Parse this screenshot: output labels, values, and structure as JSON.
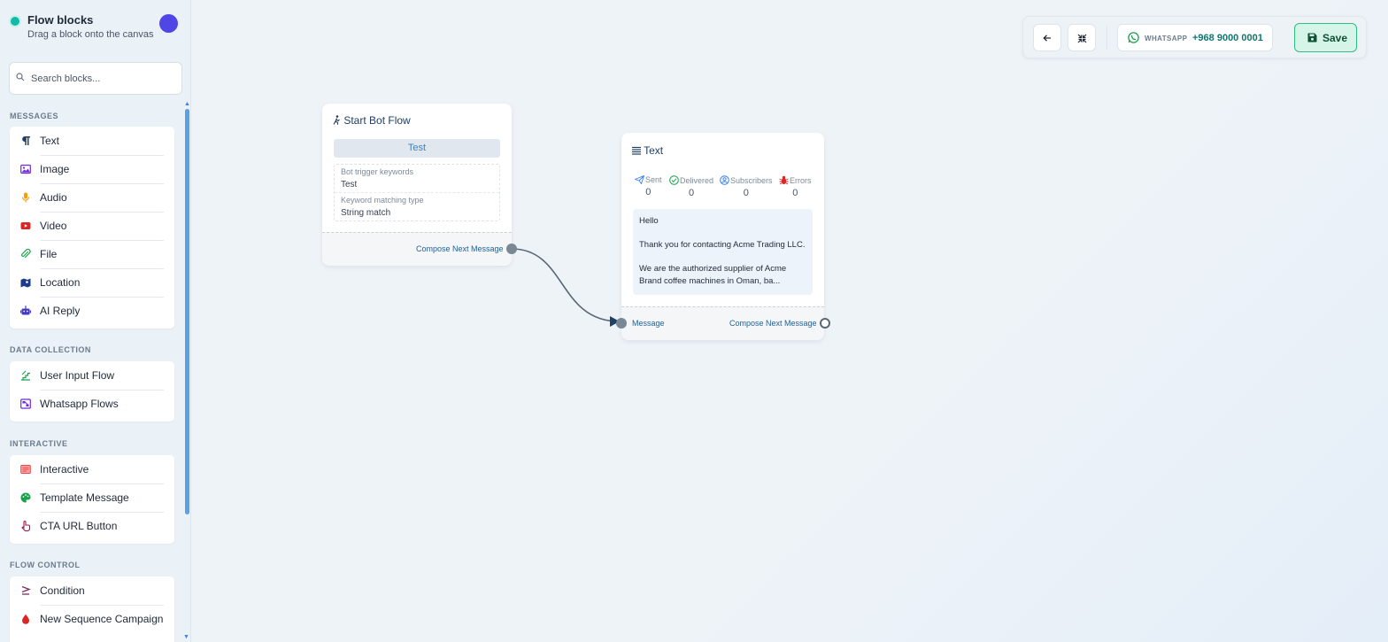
{
  "sidebar": {
    "title": "Flow blocks",
    "subtitle": "Drag a block onto the canvas",
    "search_placeholder": "Search blocks...",
    "sections": [
      {
        "title": "MESSAGES",
        "items": [
          {
            "label": "Text",
            "icon": "paragraph-icon",
            "color": "#1f3f64"
          },
          {
            "label": "Image",
            "icon": "image-icon",
            "color": "#6d28d9"
          },
          {
            "label": "Audio",
            "icon": "microphone-icon",
            "color": "#f59e0b"
          },
          {
            "label": "Video",
            "icon": "video-icon",
            "color": "#dc2626"
          },
          {
            "label": "File",
            "icon": "paperclip-icon",
            "color": "#16a34a"
          },
          {
            "label": "Location",
            "icon": "map-location-icon",
            "color": "#1e3a8a"
          },
          {
            "label": "AI Reply",
            "icon": "robot-icon",
            "color": "#4338ca"
          }
        ]
      },
      {
        "title": "DATA COLLECTION",
        "items": [
          {
            "label": "User Input Flow",
            "icon": "stairs-icon",
            "color": "#16a34a"
          },
          {
            "label": "Whatsapp Flows",
            "icon": "flow-form-icon",
            "color": "#6d28d9"
          }
        ]
      },
      {
        "title": "INTERACTIVE",
        "items": [
          {
            "label": "Interactive",
            "icon": "list-card-icon",
            "color": "#ef4444"
          },
          {
            "label": "Template Message",
            "icon": "palette-icon",
            "color": "#16a34a"
          },
          {
            "label": "CTA URL Button",
            "icon": "hand-pointer-icon",
            "color": "#9d174d"
          }
        ]
      },
      {
        "title": "FLOW CONTROL",
        "items": [
          {
            "label": "Condition",
            "icon": "greater-equal-icon",
            "color": "#7c2d5a"
          },
          {
            "label": "New Sequence Campaign",
            "icon": "drop-icon",
            "color": "#dc2626"
          }
        ]
      }
    ]
  },
  "topbar": {
    "channel_label": "WHATSAPP",
    "phone_number": "+968 9000 0001",
    "save_label": "Save"
  },
  "nodes": {
    "start": {
      "title": "Start Bot Flow",
      "test_label": "Test",
      "keywords_label": "Bot trigger keywords",
      "keywords_value": "Test",
      "matching_label": "Keyword matching type",
      "matching_value": "String match",
      "compose_label": "Compose Next Message"
    },
    "text": {
      "title": "Text",
      "stats": [
        {
          "label": "Sent",
          "value": "0",
          "color": "#3b82f6"
        },
        {
          "label": "Delivered",
          "value": "0",
          "color": "#16a34a"
        },
        {
          "label": "Subscribers",
          "value": "0",
          "color": "#3b82f6"
        },
        {
          "label": "Errors",
          "value": "0",
          "color": "#dc2626"
        }
      ],
      "message_lines": [
        "Hello",
        "Thank you for contacting Acme Trading LLC.",
        "We are the authorized supplier of Acme Brand coffee machines in Oman, ba..."
      ],
      "input_label": "Message",
      "compose_label": "Compose Next Message"
    }
  },
  "colors": {
    "accent": "#4f46e5",
    "save_green": "#2fbf7e",
    "link_blue": "#1f5f99"
  }
}
